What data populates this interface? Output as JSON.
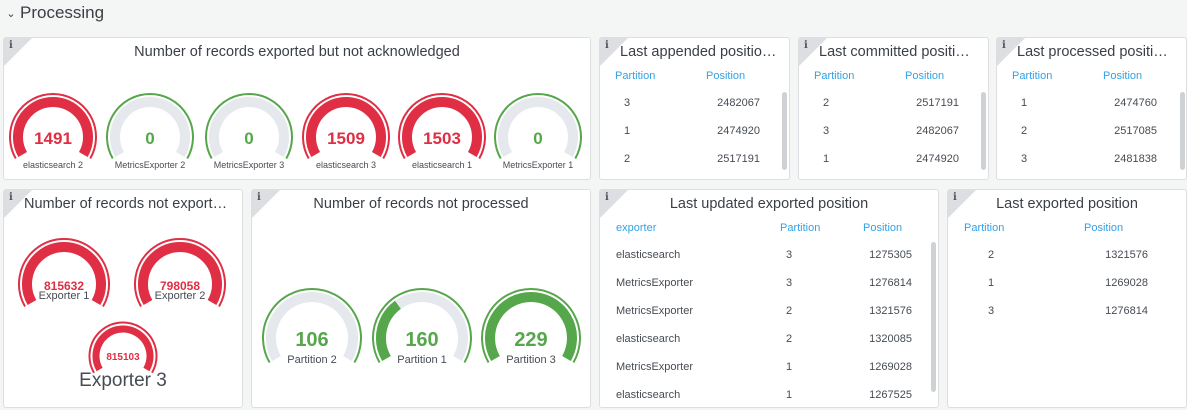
{
  "row": {
    "title": "Processing"
  },
  "colors": {
    "red": "#e02f44",
    "green": "#56a64b",
    "track": "#e5e8ec",
    "header_blue": "#33a2e5"
  },
  "icons": {
    "info": "i",
    "chevron": "⌄"
  },
  "panels": {
    "exported_not_ack": {
      "title": "Number of records exported but not acknowledged",
      "gauges": [
        {
          "value": "1491",
          "label": "elasticsearch 2",
          "fraction": 1.0,
          "color": "#e02f44"
        },
        {
          "value": "0",
          "label": "MetricsExporter 2",
          "fraction": 0.0,
          "color": "#56a64b"
        },
        {
          "value": "0",
          "label": "MetricsExporter 3",
          "fraction": 0.0,
          "color": "#56a64b"
        },
        {
          "value": "1509",
          "label": "elasticsearch 3",
          "fraction": 1.0,
          "color": "#e02f44"
        },
        {
          "value": "1503",
          "label": "elasticsearch 1",
          "fraction": 1.0,
          "color": "#e02f44"
        },
        {
          "value": "0",
          "label": "MetricsExporter 1",
          "fraction": 0.0,
          "color": "#56a64b"
        }
      ]
    },
    "last_appended": {
      "title": "Last appended positio…",
      "headers": [
        "Partition",
        "Position"
      ],
      "rows": [
        [
          "3",
          "2482067"
        ],
        [
          "1",
          "2474920"
        ],
        [
          "2",
          "2517191"
        ]
      ]
    },
    "last_committed": {
      "title": "Last committed positi…",
      "headers": [
        "Partition",
        "Position"
      ],
      "rows": [
        [
          "2",
          "2517191"
        ],
        [
          "3",
          "2482067"
        ],
        [
          "1",
          "2474920"
        ]
      ]
    },
    "last_processed": {
      "title": "Last processed positi…",
      "headers": [
        "Partition",
        "Position"
      ],
      "rows": [
        [
          "1",
          "2474760"
        ],
        [
          "2",
          "2517085"
        ],
        [
          "3",
          "2481838"
        ]
      ]
    },
    "not_exported": {
      "title": "Number of records not export…",
      "gauges": [
        {
          "value": "815632",
          "label": "Exporter 1",
          "fraction": 1.0,
          "color": "#e02f44"
        },
        {
          "value": "798058",
          "label": "Exporter 2",
          "fraction": 1.0,
          "color": "#e02f44"
        },
        {
          "value": "815103",
          "label": "Exporter 3",
          "fraction": 1.0,
          "color": "#e02f44"
        }
      ]
    },
    "not_processed": {
      "title": "Number of records not processed",
      "gauges": [
        {
          "value": "106",
          "label": "Partition 2",
          "fraction": 0.0,
          "color": "#56a64b"
        },
        {
          "value": "160",
          "label": "Partition 1",
          "fraction": 0.35,
          "color": "#56a64b"
        },
        {
          "value": "229",
          "label": "Partition 3",
          "fraction": 1.0,
          "color": "#56a64b"
        }
      ]
    },
    "last_updated_exported": {
      "title": "Last updated exported position",
      "headers": [
        "exporter",
        "Partition",
        "Position"
      ],
      "rows": [
        [
          "elasticsearch",
          "3",
          "1275305"
        ],
        [
          "MetricsExporter",
          "3",
          "1276814"
        ],
        [
          "MetricsExporter",
          "2",
          "1321576"
        ],
        [
          "elasticsearch",
          "2",
          "1320085"
        ],
        [
          "MetricsExporter",
          "1",
          "1269028"
        ],
        [
          "elasticsearch",
          "1",
          "1267525"
        ]
      ]
    },
    "last_exported": {
      "title": "Last exported position",
      "headers": [
        "Partition",
        "Position"
      ],
      "rows": [
        [
          "2",
          "1321576"
        ],
        [
          "1",
          "1269028"
        ],
        [
          "3",
          "1276814"
        ]
      ]
    }
  }
}
